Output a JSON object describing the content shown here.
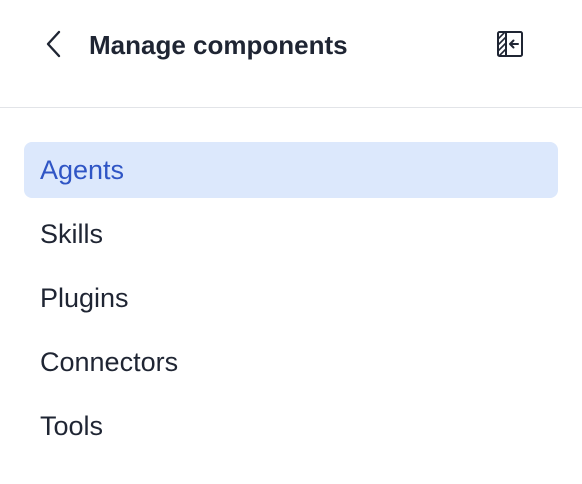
{
  "header": {
    "title": "Manage components",
    "back_icon": "chevron-left-icon",
    "collapse_icon": "collapse-panel-icon"
  },
  "nav": {
    "items": [
      {
        "label": "Agents",
        "active": true
      },
      {
        "label": "Skills",
        "active": false
      },
      {
        "label": "Plugins",
        "active": false
      },
      {
        "label": "Connectors",
        "active": false
      },
      {
        "label": "Tools",
        "active": false
      }
    ]
  },
  "colors": {
    "text": "#1f2533",
    "active_text": "#2f55c5",
    "active_background": "#dce8fc",
    "divider": "#e2e4e8"
  }
}
